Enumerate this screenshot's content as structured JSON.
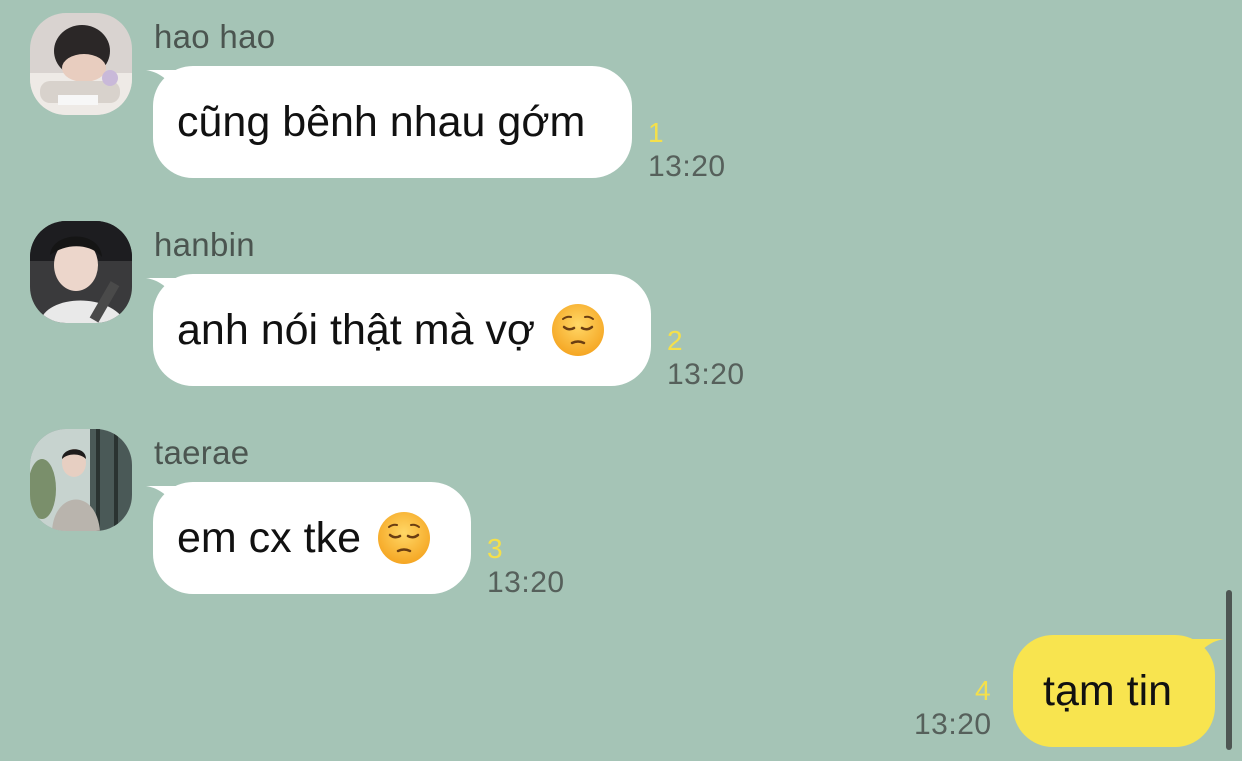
{
  "messages": [
    {
      "sender": "hao hao",
      "text": "cũng bênh nhau gớm",
      "emoji": "",
      "unread": "1",
      "time": "13:20",
      "direction": "incoming"
    },
    {
      "sender": "hanbin",
      "text": "anh nói thật mà vợ",
      "emoji": "pensive-face-emoji",
      "unread": "2",
      "time": "13:20",
      "direction": "incoming"
    },
    {
      "sender": "taerae",
      "text": "em cx tke",
      "emoji": "pensive-face-emoji",
      "unread": "3",
      "time": "13:20",
      "direction": "incoming"
    },
    {
      "sender": "",
      "text": "tạm tin",
      "emoji": "",
      "unread": "4",
      "time": "13:20",
      "direction": "outgoing"
    }
  ],
  "colors": {
    "background": "#a5c4b6",
    "incoming_bubble": "#ffffff",
    "outgoing_bubble": "#f8e44f",
    "unread_count": "#f5e04a",
    "timestamp": "#56605b"
  }
}
